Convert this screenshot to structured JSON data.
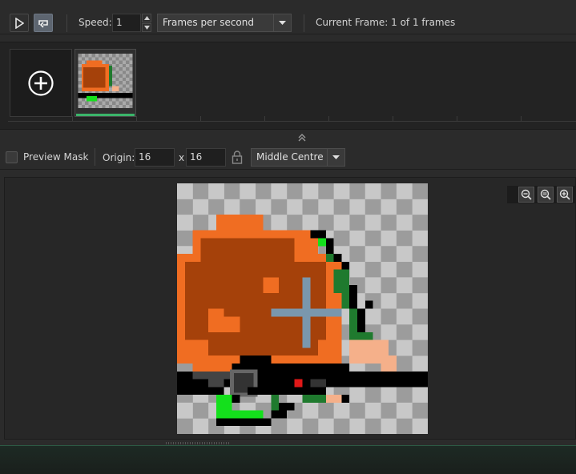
{
  "toolbar": {
    "play_icon": "play-icon",
    "loop_icon": "loop-icon",
    "speed_label": "Speed:",
    "speed_value": "1",
    "speed_unit": "Frames per second",
    "current_frame": "Current Frame: 1 of 1 frames"
  },
  "frames": {
    "add_icon": "add-frame-icon",
    "count": 1
  },
  "mask": {
    "preview_mask_label": "Preview Mask",
    "preview_mask_checked": false,
    "origin_label": "Origin:",
    "origin_x": "16",
    "origin_sep": "x",
    "origin_y": "16",
    "lock_icon": "lock-icon",
    "origin_preset": "Middle Centre"
  },
  "zoom": {
    "buttons": [
      "zoom-out-icon",
      "zoom-reset-icon",
      "zoom-in-icon"
    ]
  },
  "colors": {
    "accent": "#3bb56a",
    "sprite_hair": "#a5410a",
    "sprite_orange": "#f06d22",
    "sprite_green": "#1f7a2e",
    "sprite_bright_green": "#14e01c",
    "sprite_skin": "#f5b08a"
  }
}
